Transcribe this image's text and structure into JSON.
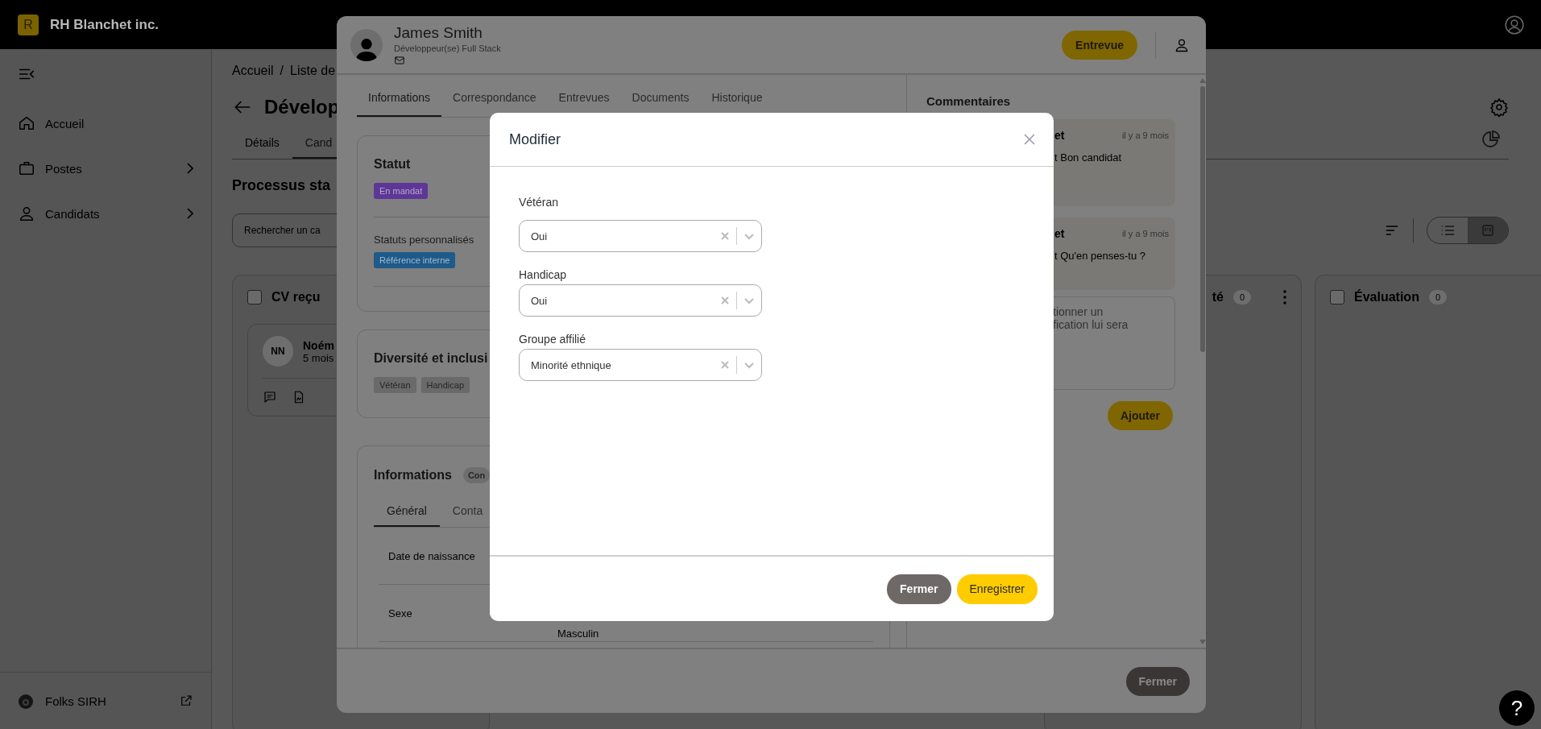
{
  "top_bar": {
    "logo_letter": "R",
    "company": "RH Blanchet inc."
  },
  "sidebar": {
    "items": [
      {
        "label": "Accueil",
        "kind": "home",
        "has_submenu": false
      },
      {
        "label": "Postes",
        "kind": "briefcase",
        "has_submenu": true
      },
      {
        "label": "Candidats",
        "kind": "person",
        "has_submenu": true
      }
    ],
    "footer": {
      "label": "Folks SIRH"
    }
  },
  "page": {
    "breadcrumb": [
      "Accueil",
      "Liste de"
    ],
    "breadcrumb_separator": "/",
    "title": "Dévelop",
    "tabs": [
      {
        "label": "Détails",
        "selected": false
      },
      {
        "label": "Cand",
        "selected": true
      }
    ],
    "section_title": "Processus sta",
    "search": {
      "placeholder": "Rechercher un ca"
    },
    "view_toggle": [
      {
        "kind": "list",
        "selected": false
      },
      {
        "kind": "kanban",
        "selected": true
      }
    ],
    "columns": [
      {
        "title": "CV reçu",
        "checked": false,
        "cards": [
          {
            "initials": "NN",
            "name": "Noém",
            "time": "5 mois"
          }
        ]
      },
      {
        "title": "té",
        "count": "0"
      },
      {
        "title": "Évaluation",
        "count": "0",
        "checked": false
      }
    ]
  },
  "candidate": {
    "name": "James Smith",
    "role": "Développeur(se) Full Stack",
    "primary_action": "Entrevue",
    "tabs": [
      {
        "label": "Informations",
        "selected": true
      },
      {
        "label": "Correspondance",
        "selected": false
      },
      {
        "label": "Entrevues",
        "selected": false
      },
      {
        "label": "Documents",
        "selected": false
      },
      {
        "label": "Historique",
        "selected": false
      }
    ],
    "status_card": {
      "title": "Statut",
      "status_badge": "En mandat",
      "custom_label": "Statuts personnalisés",
      "custom_badges": [
        "Référence interne"
      ]
    },
    "diversity_card": {
      "title": "Diversité et inclusi",
      "badges": [
        "Vétéran",
        "Handicap"
      ]
    },
    "info_card": {
      "title": "Informations",
      "badge": "Con",
      "tabs": [
        {
          "label": "Général",
          "selected": true
        },
        {
          "label": "Conta",
          "selected": false
        }
      ],
      "rows": [
        {
          "label": "Date de naissance"
        },
        {
          "label": "Sexe",
          "value": "Masculin"
        }
      ]
    },
    "comments": {
      "title": "Commentaires",
      "items": [
        {
          "author": "et",
          "time": "il y a 9 mois",
          "text": "t Bon candidat"
        },
        {
          "author": "et",
          "time": "il y a 9 mois",
          "text": "t Qu'en penses-tu ?"
        }
      ],
      "input": {
        "placeholder": "tionner un\nfication lui sera"
      },
      "submit": "Ajouter"
    },
    "footer_button": "Fermer"
  },
  "dialog": {
    "title": "Modifier",
    "fields": [
      {
        "label": "Vétéran",
        "value": "Oui"
      },
      {
        "label": "Handicap",
        "value": "Oui"
      },
      {
        "label": "Groupe affilié",
        "value": "Minorité ethnique"
      }
    ],
    "buttons": [
      {
        "label": "Fermer",
        "kind": "secondary"
      },
      {
        "label": "Enregistrer",
        "kind": "primary"
      }
    ]
  },
  "help": {
    "label": "?"
  }
}
